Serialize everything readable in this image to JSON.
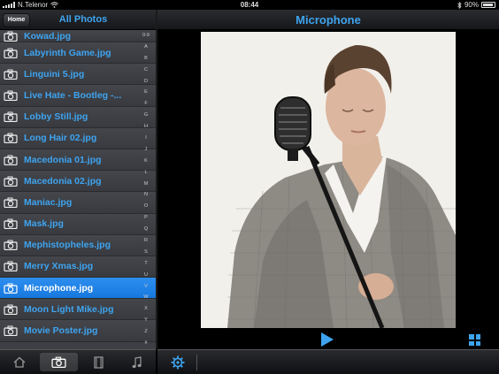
{
  "statusbar": {
    "carrier": "N.Telenor",
    "time": "08:44",
    "battery": "90%"
  },
  "left": {
    "home_label": "Home",
    "title": "All Photos",
    "files": [
      "Kowad.jpg",
      "Labyrinth Game.jpg",
      "Linguini 5.jpg",
      "Live Hate  -  Bootleg -...",
      "Lobby Still.jpg",
      "Long Hair 02.jpg",
      "Macedonia 01.jpg",
      "Macedonia 02.jpg",
      "Maniac.jpg",
      "Mask.jpg",
      "Mephistopheles.jpg",
      "Merry Xmas.jpg",
      "Microphone.jpg",
      "Moon Light Mike.jpg",
      "Movie Poster.jpg"
    ],
    "selected_file": "Microphone.jpg",
    "index_letters": [
      "0-9",
      "A",
      "B",
      "C",
      "D",
      "E",
      "F",
      "G",
      "H",
      "I",
      "J",
      "K",
      "L",
      "M",
      "N",
      "O",
      "P",
      "Q",
      "R",
      "S",
      "T",
      "U",
      "V",
      "W",
      "X",
      "Y",
      "Z",
      "#"
    ]
  },
  "right": {
    "title": "Microphone"
  },
  "tabs": [
    {
      "icon": "home-icon"
    },
    {
      "icon": "camera-icon",
      "active": true
    },
    {
      "icon": "film-icon"
    },
    {
      "icon": "music-icon"
    }
  ],
  "bottom_right": {
    "settings_icon": "gear-icon",
    "play_icon": "play-icon",
    "grid_icon": "grid-icon"
  },
  "colors": {
    "accent": "#3ea4f0",
    "selected_row": "#1a80e8",
    "panel": "#3d3f44"
  }
}
